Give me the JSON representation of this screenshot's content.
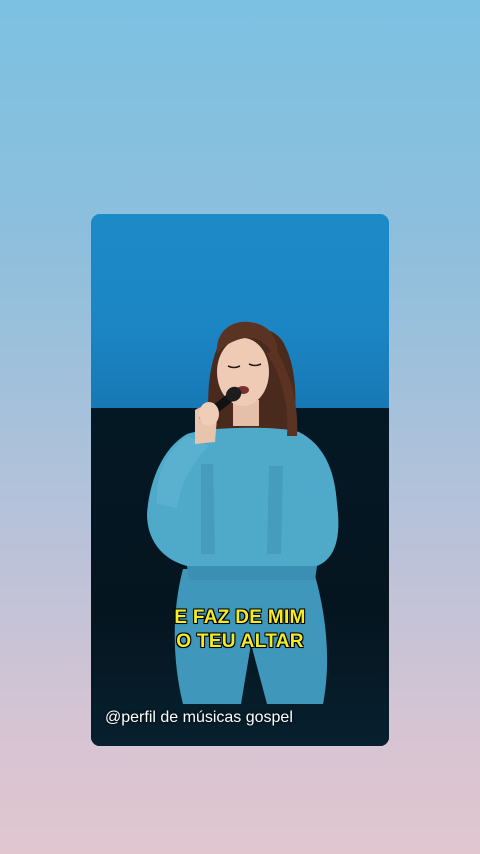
{
  "video": {
    "lyrics_line1": "E FAZ DE MIM",
    "lyrics_line2": "O TEU ALTAR",
    "watermark": "@perfil de músicas gospel"
  },
  "colors": {
    "background_top": "#7cc1e2",
    "background_bottom": "#e1c6cf",
    "lyrics": "#f3ec28",
    "stage_backdrop": "#1d8ac8",
    "denim": "#4fa9c9"
  }
}
